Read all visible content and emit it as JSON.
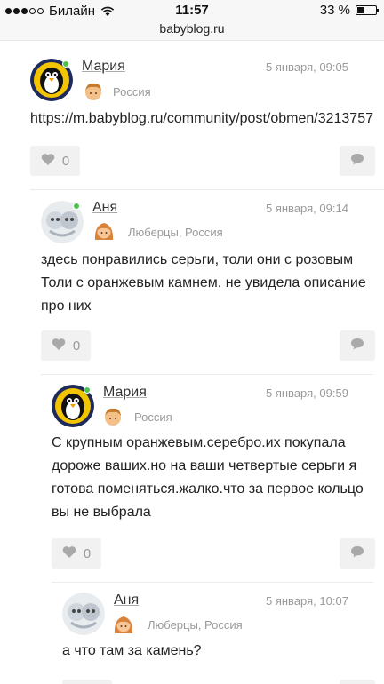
{
  "status_bar": {
    "carrier": "Билайн",
    "time": "11:57",
    "battery": "33 %",
    "battery_level": 0.33
  },
  "browser": {
    "url": "babyblog.ru"
  },
  "comments": [
    {
      "author": "Мария",
      "date": "5 января, 09:05",
      "location": "Россия",
      "text": "https://m.babyblog.ru/community/post/obmen/3213757",
      "likes": "0"
    },
    {
      "author": "Аня",
      "date": "5 января, 09:14",
      "location": "Люберцы, Россия",
      "text": "здесь понравились серьги, толи они с розовым\nТоли с оранжевым камнем. не увидела описание\nпро них",
      "likes": "0"
    },
    {
      "author": "Мария",
      "date": "5 января, 09:59",
      "location": "Россия",
      "text": "С крупным оранжевым.серебро.их покупала\nдороже ваших.но на ваши четвертые серьги я\nготова поменяться.жалко.что за первое кольцо\nвы не выбрала",
      "likes": "0"
    },
    {
      "author": "Аня",
      "date": "5 января, 10:07",
      "location": "Люберцы, Россия",
      "text": "а что там за камень?"
    }
  ]
}
